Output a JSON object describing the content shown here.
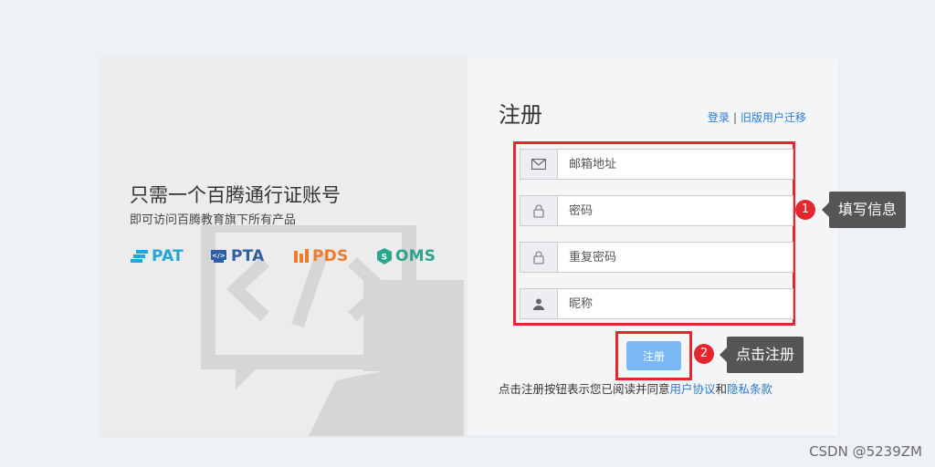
{
  "promo": {
    "headline": "只需一个百腾通行证账号",
    "subline": "即可访问百腾教育旗下所有产品",
    "brands": [
      {
        "label": "PAT",
        "color": "#23a6dc"
      },
      {
        "label": "PTA",
        "color": "#2d5ea8"
      },
      {
        "label": "PDS",
        "color": "#f07b2c"
      },
      {
        "label": "OMS",
        "color": "#2aa58e"
      }
    ]
  },
  "register": {
    "title": "注册",
    "login_link": "登录",
    "migrate_link": "旧版用户迁移",
    "fields": {
      "email": {
        "placeholder": "邮箱地址",
        "icon": "envelope-icon"
      },
      "password": {
        "placeholder": "密码",
        "icon": "lock-icon"
      },
      "confirm_password": {
        "placeholder": "重复密码",
        "icon": "lock-icon"
      },
      "nickname": {
        "placeholder": "昵称",
        "icon": "user-icon"
      }
    },
    "submit_label": "注册",
    "agreement_prefix": "点击注册按钮表示您已阅读并同意",
    "user_agreement": "用户协议",
    "and": "和",
    "privacy": "隐私条款"
  },
  "annotations": [
    {
      "number": "1",
      "text": "填写信息"
    },
    {
      "number": "2",
      "text": "点击注册"
    }
  ],
  "watermark": "CSDN @5239ZM",
  "colors": {
    "accent": "#2c7bd1",
    "button": "#7ab8f5",
    "highlight": "#e5262f",
    "tooltip": "#555555"
  }
}
